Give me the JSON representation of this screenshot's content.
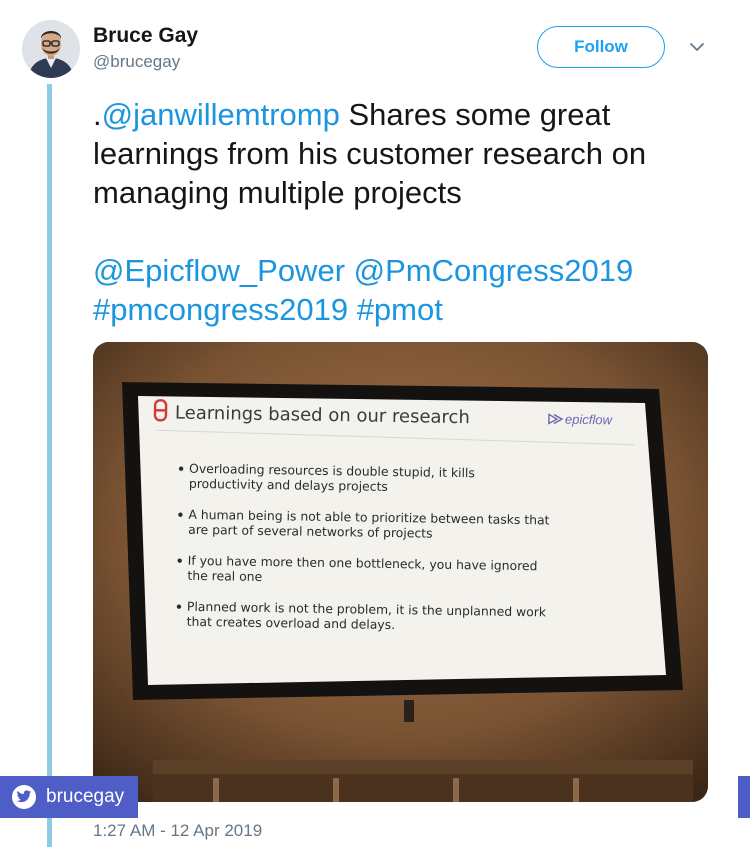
{
  "author": {
    "display_name": "Bruce Gay",
    "handle": "@brucegay",
    "avatar_icon": "user-photo"
  },
  "follow_label": "Follow",
  "menu_icon": "chevron-down-icon",
  "tweet": {
    "line1_prefix": ".",
    "line1_mention": "@janwillemtromp",
    "line1_rest": " Shares some great",
    "line2": "learnings from his customer research on",
    "line3": "managing multiple projects",
    "mention_epicflow": "@Epicflow_Power",
    "mention_pmcongress": "@PmCongress2019",
    "hashtag_pmcongress": "#pmcongress2019",
    "hashtag_pmot": "#pmot"
  },
  "slide": {
    "title": "Learnings based on our research",
    "brand": "epicflow",
    "bullets": [
      {
        "line1": "Overloading resources is double stupid, it kills",
        "line2": "productivity and delays projects"
      },
      {
        "line1": "A human being is not able to prioritize between tasks that",
        "line2": "are part of several networks of projects"
      },
      {
        "line1": "If you have more then one bottleneck, you have ignored",
        "line2": "the real one"
      },
      {
        "line1": "Planned work is not the problem, it is the unplanned work",
        "line2": "that creates overload and delays."
      }
    ]
  },
  "badge": {
    "icon": "twitter-bird-icon",
    "label": "brucegay"
  },
  "timestamp": "1:27 AM - 12 Apr 2019",
  "colors": {
    "link": "#1b95e0",
    "follow": "#1da1f2",
    "thread": "#8ecae4",
    "badge": "#4f5ec6"
  }
}
